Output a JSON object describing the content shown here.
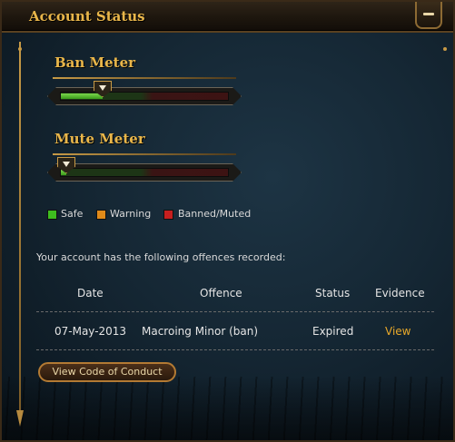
{
  "window": {
    "title": "Account Status"
  },
  "ban_meter": {
    "label": "Ban Meter",
    "level": 0.25
  },
  "mute_meter": {
    "label": "Mute Meter",
    "level": 0.03
  },
  "legend": [
    {
      "label": "Safe",
      "color": "#3ebd1f"
    },
    {
      "label": "Warning",
      "color": "#e08a19"
    },
    {
      "label": "Banned/Muted",
      "color": "#c61f1f"
    }
  ],
  "offences": {
    "intro": "Your account has the following offences recorded:",
    "headers": {
      "date": "Date",
      "offence": "Offence",
      "status": "Status",
      "evidence": "Evidence"
    },
    "rows": [
      {
        "date": "07-May-2013",
        "offence": "Macroing Minor (ban)",
        "status": "Expired",
        "evidence": "View"
      }
    ]
  },
  "buttons": {
    "code_of_conduct": "View Code of Conduct"
  },
  "colors": {
    "accent": "#e9b64a",
    "link": "#e8a82a",
    "panel_bg": "#152734"
  }
}
